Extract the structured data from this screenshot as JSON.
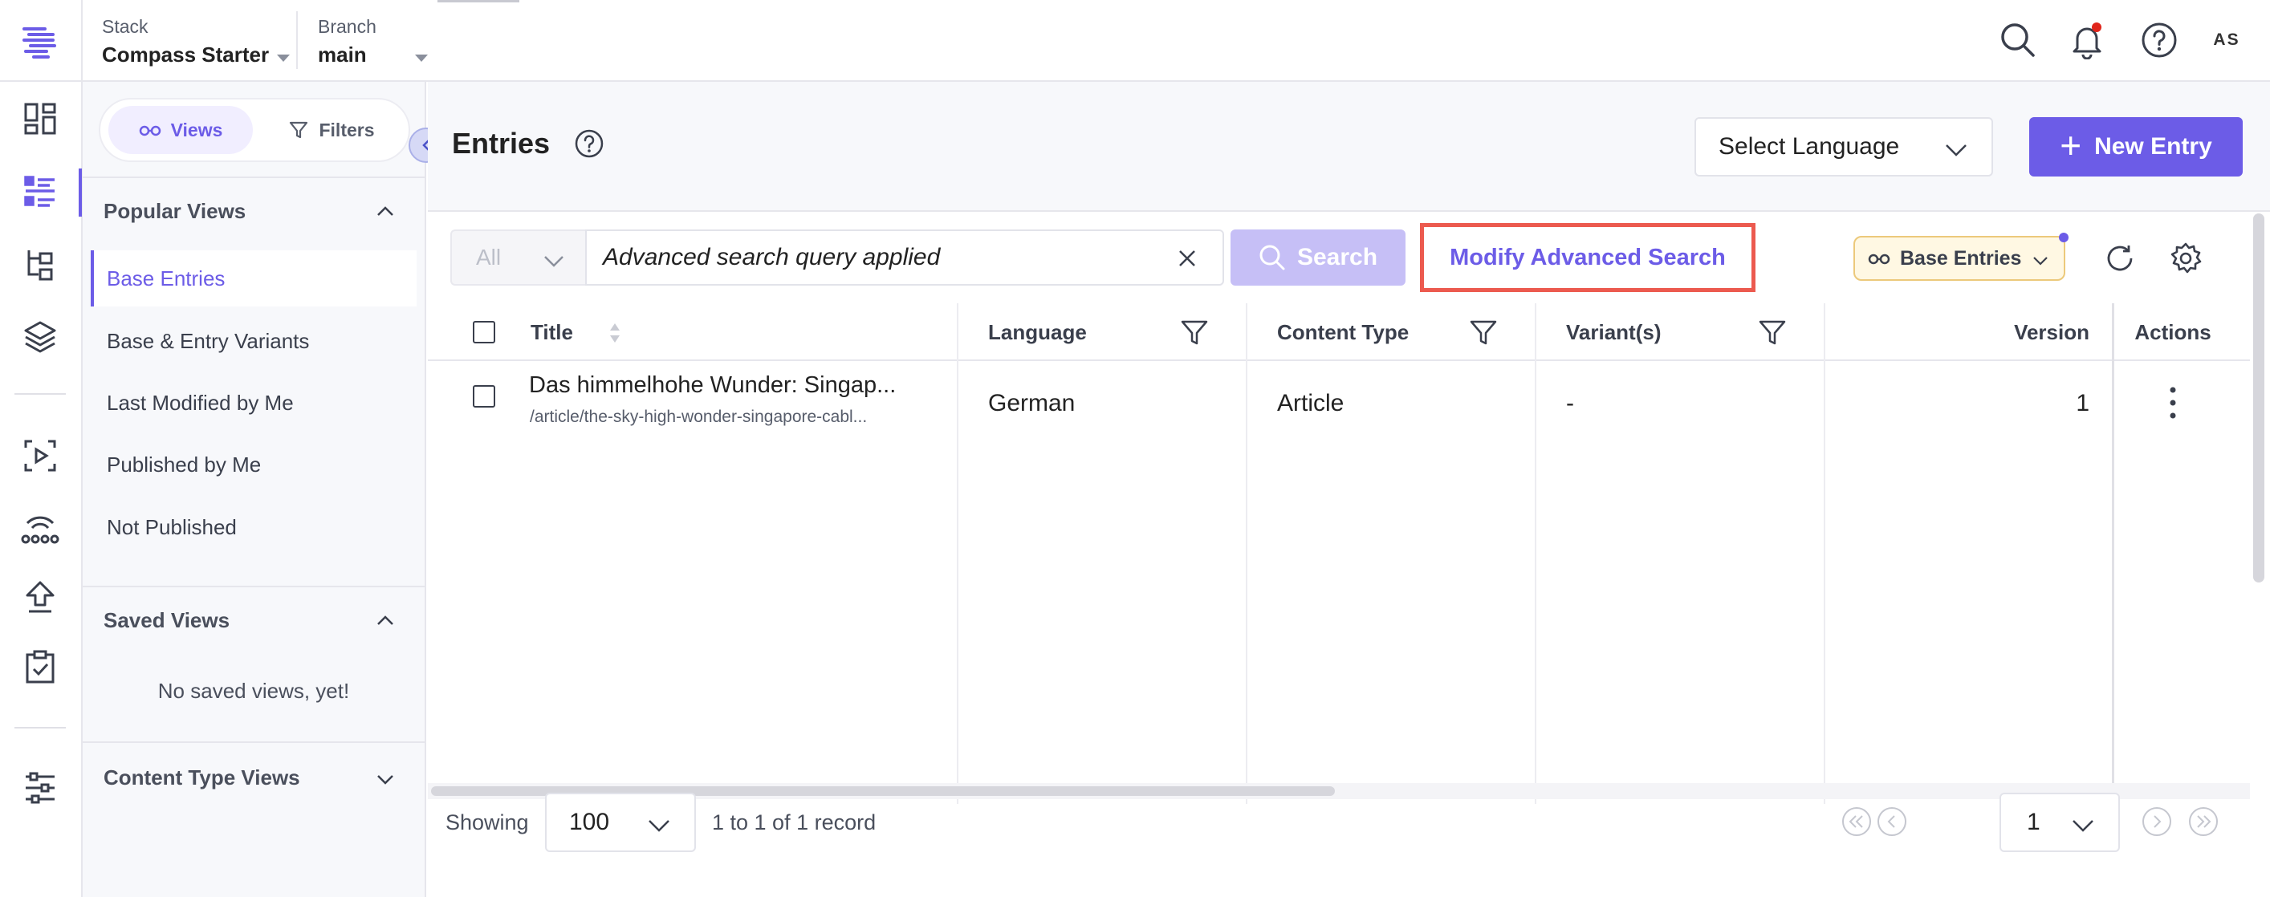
{
  "topbar": {
    "stack_label": "Stack",
    "stack_value": "Compass Starter",
    "branch_label": "Branch",
    "branch_value": "main",
    "avatar_initials": "AS"
  },
  "icons": {
    "logo": "contentstack-logo-icon",
    "search": "search-icon",
    "notifications": "bell-icon",
    "help": "help-icon",
    "rail": [
      "dashboard-icon",
      "entries-list-icon",
      "content-models-icon",
      "assets-layers-icon",
      "releases-play-icon",
      "webhooks-icon",
      "deploy-upload-icon",
      "tasks-clipboard-icon",
      "settings-sliders-icon"
    ]
  },
  "views_panel": {
    "views_tab": "Views",
    "filters_tab": "Filters",
    "popular_views_heading": "Popular Views",
    "popular_views": [
      {
        "label": "Base Entries",
        "active": true
      },
      {
        "label": "Base & Entry Variants",
        "active": false
      },
      {
        "label": "Last Modified by Me",
        "active": false
      },
      {
        "label": "Published by Me",
        "active": false
      },
      {
        "label": "Not Published",
        "active": false
      }
    ],
    "saved_views_heading": "Saved Views",
    "saved_views_empty": "No saved views, yet!",
    "content_type_views_heading": "Content Type Views"
  },
  "header": {
    "title": "Entries",
    "language_select": "Select Language",
    "new_entry_label": "New Entry"
  },
  "search": {
    "scope": "All",
    "query_text": "Advanced search query applied",
    "search_button": "Search",
    "modify_button": "Modify Advanced Search",
    "view_pill": "Base Entries"
  },
  "table": {
    "columns": [
      "Title",
      "Language",
      "Content Type",
      "Variant(s)",
      "Version",
      "Actions"
    ],
    "rows": [
      {
        "title": "Das himmelhohe Wunder: Singap...",
        "url": "/article/the-sky-high-wonder-singapore-cabl...",
        "language": "German",
        "content_type": "Article",
        "variants": "-",
        "version": "1"
      }
    ]
  },
  "footer": {
    "showing_label": "Showing",
    "per_page": "100",
    "record_count": "1 to 1 of 1 record",
    "current_page": "1"
  },
  "colors": {
    "accent": "#6c5ce7",
    "highlight_border": "#ec5a4f",
    "notification_dot": "#e0251b"
  }
}
